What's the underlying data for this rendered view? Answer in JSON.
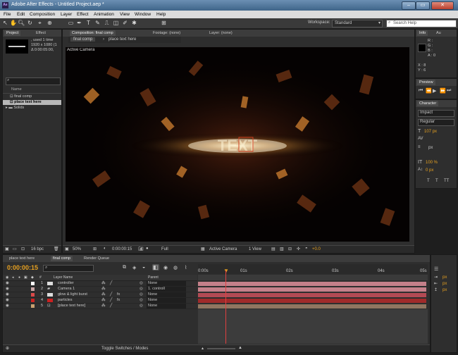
{
  "window": {
    "title": "Adobe After Effects - Untitled Project.aep *",
    "app_icon": "Ae"
  },
  "menu": [
    "File",
    "Edit",
    "Composition",
    "Layer",
    "Effect",
    "Animation",
    "View",
    "Window",
    "Help"
  ],
  "toolbar": {
    "workspace_label": "Workspace:",
    "workspace_value": "Standard",
    "search_placeholder": "Search Help"
  },
  "project_panel": {
    "tabs": [
      "Project",
      "Effect"
    ],
    "info_line1": ", used 1 time",
    "info_line2": "1920 x 1080  (1",
    "info_line3": "Δ 0:00:05:00, ",
    "column_name": "Name",
    "items": [
      {
        "name": "final comp",
        "type": "comp"
      },
      {
        "name": "place text here",
        "type": "comp",
        "selected": true
      },
      {
        "name": "Solids",
        "type": "folder"
      }
    ],
    "bpc": "16 bpc"
  },
  "comp_panel": {
    "tabs": [
      "Composition: final comp",
      "Footage: (none)",
      "Layer: (none)"
    ],
    "subtabs": [
      "final comp",
      "place text here"
    ],
    "camera_label": "Active Camera",
    "footer": {
      "zoom": "50%",
      "timecode": "0:00:00:15",
      "resolution": "Full",
      "camera": "Active Camera",
      "views": "1 View",
      "exposure": "+0.0"
    }
  },
  "info_panel": {
    "tabs": [
      "Info",
      "Au"
    ],
    "r": "R :",
    "g": "G :",
    "b": "B :",
    "a": "A : 0",
    "x": "X : 8",
    "y": "Y : 6"
  },
  "preview_panel": {
    "title": "Preview"
  },
  "character_panel": {
    "title": "Character",
    "font": "Impact",
    "style": "Regular",
    "size": "107 px",
    "tracking": "px",
    "scale": "100 %",
    "baseline": "0 px"
  },
  "timeline": {
    "tabs": [
      "place text here",
      "final comp",
      "Render Queue"
    ],
    "timecode": "0:00:00:15",
    "columns": {
      "layer_name": "Layer Name",
      "parent": "Parent"
    },
    "ruler": [
      "0:00s",
      "01s",
      "02s",
      "03s",
      "04s",
      "05s"
    ],
    "layers": [
      {
        "num": "1",
        "name": "controller",
        "color": "#ffffff",
        "parent": "None",
        "bar": "#c4808a"
      },
      {
        "num": "2",
        "name": "Camera 1",
        "color": "#c9a6a6",
        "parent": "1. controll",
        "bar": "#c4808a"
      },
      {
        "num": "3",
        "name": "glow & light burst",
        "color": "#d94a4a",
        "parent": "None",
        "bar": "#b34a54"
      },
      {
        "num": "4",
        "name": "particles",
        "color": "#cc2020",
        "parent": "None",
        "bar": "#a02a2a"
      },
      {
        "num": "5",
        "name": "[place text here]",
        "color": "#c8a070",
        "parent": "None",
        "bar": "#8f7560"
      }
    ],
    "footer": "Toggle Switches / Modes"
  },
  "right_strip": {
    "labels": [
      "px",
      "px",
      "px"
    ]
  },
  "colors": {
    "accent": "#e6a020",
    "playhead": "#e04040"
  }
}
